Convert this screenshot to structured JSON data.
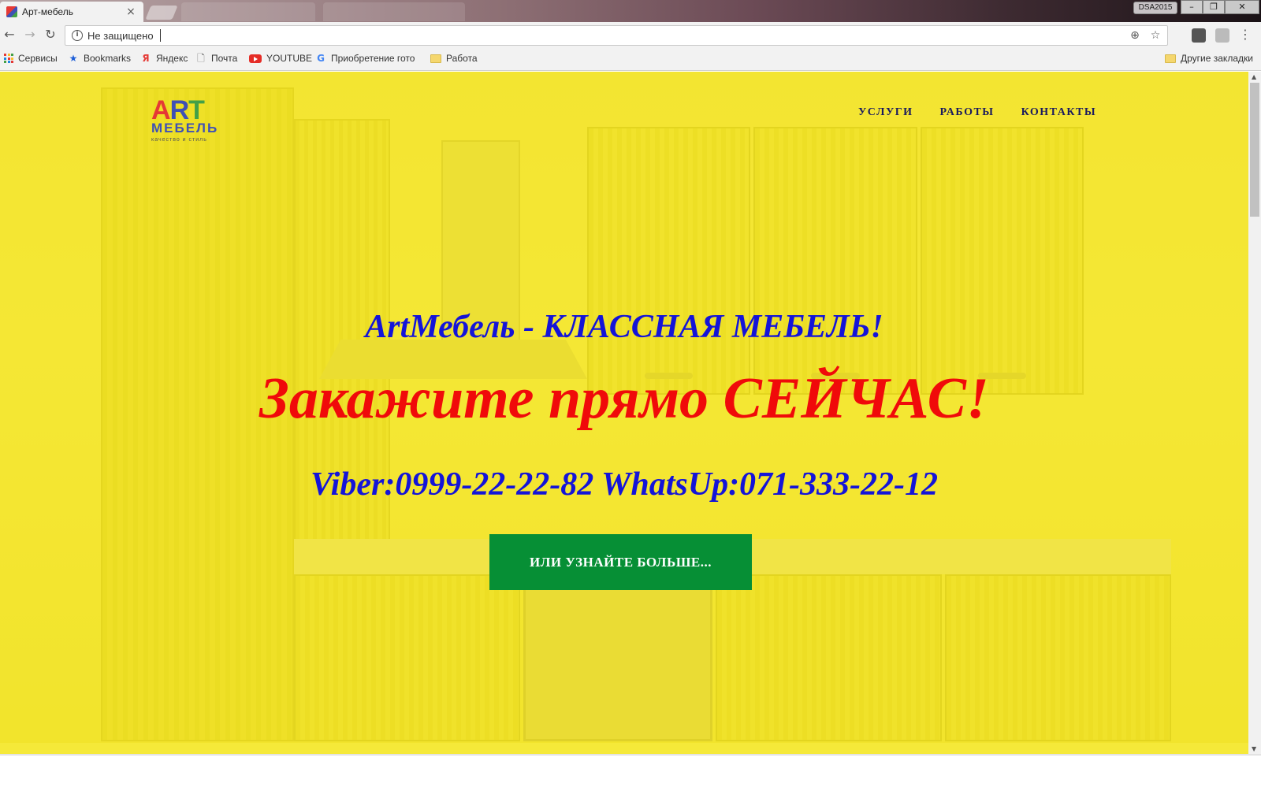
{
  "browser": {
    "tab_title": "Арт-мебель",
    "tab_close": "×",
    "window_user": "DSA2015",
    "window_controls": {
      "minimize": "–",
      "restore": "❐",
      "close": "✕"
    },
    "nav": {
      "back": "←",
      "forward": "→",
      "reload": "↻"
    },
    "omnibox": {
      "security_icon": "i",
      "security_text": "Не защищено",
      "url": "",
      "zoom_icon": "⊕",
      "star_icon": "☆"
    },
    "menu_icon": "⋮"
  },
  "bookmarks": {
    "items": [
      {
        "label": "Сервисы",
        "icon": "apps-grid-icon"
      },
      {
        "label": "Bookmarks",
        "icon": "star-icon",
        "glyph": "★"
      },
      {
        "label": "Яндекс",
        "icon": "yandex-icon",
        "glyph": "Я"
      },
      {
        "label": "Почта",
        "icon": "page-icon",
        "glyph": "🗋"
      },
      {
        "label": "YOUTUBE",
        "icon": "youtube-icon"
      },
      {
        "label": "Приобретение гото",
        "icon": "google-icon",
        "glyph": "G"
      },
      {
        "label": "Работа",
        "icon": "folder-icon"
      }
    ],
    "other": "Другие закладки"
  },
  "site": {
    "logo": {
      "letters": [
        "A",
        "R",
        "T"
      ],
      "word": "МЕБЕЛЬ",
      "tagline": "качество и стиль"
    },
    "nav": [
      "УСЛУГИ",
      "РАБОТЫ",
      "КОНТАКТЫ"
    ],
    "tagline": "ArtМебель - КЛАССНАЯ МЕБЕЛЬ!",
    "order": "Закажите прямо СЕЙЧАС!",
    "phones": "Viber:0999-22-22-82 WhatsUp:071-333-22-12",
    "cta": "ИЛИ УЗНАЙТЕ БОЛЬШЕ..."
  },
  "colors": {
    "overlay_yellow": "#f0e12c",
    "tagline_blue": "#1414d8",
    "order_red": "#f00a0a",
    "cta_green": "#068f35",
    "nav_text": "#1a1a5e"
  }
}
